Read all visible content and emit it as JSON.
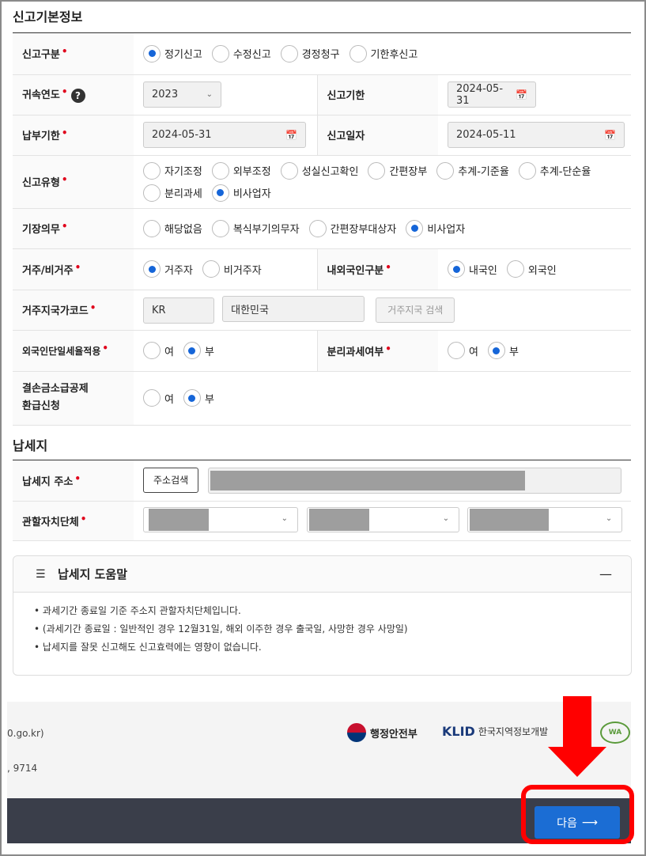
{
  "section_basic": {
    "title": "신고기본정보"
  },
  "rows": {
    "report_type": {
      "label": "신고구분",
      "options": [
        "정기신고",
        "수정신고",
        "경정청구",
        "기한후신고"
      ],
      "selected": 0
    },
    "year": {
      "label": "귀속연도",
      "help_icon": "?",
      "value": "2023"
    },
    "report_deadline": {
      "label": "신고기한",
      "value": "2024-05-31"
    },
    "pay_deadline": {
      "label": "납부기한",
      "value": "2024-05-31"
    },
    "report_date": {
      "label": "신고일자",
      "value": "2024-05-11"
    },
    "report_kind": {
      "label": "신고유형",
      "options": [
        "자기조정",
        "외부조정",
        "성실신고확인",
        "간편장부",
        "추계-기준율",
        "추계-단순율",
        "분리과세",
        "비사업자"
      ],
      "selected": 7
    },
    "bookkeeping": {
      "label": "기장의무",
      "options": [
        "해당없음",
        "복식부기의무자",
        "간편장부대상자",
        "비사업자"
      ],
      "selected": 3
    },
    "residency": {
      "label": "거주/비거주",
      "options": [
        "거주자",
        "비거주자"
      ],
      "selected": 0
    },
    "nationality": {
      "label": "내외국인구분",
      "options": [
        "내국인",
        "외국인"
      ],
      "selected": 0
    },
    "country_code": {
      "label": "거주지국가코드",
      "code": "KR",
      "name": "대한민국",
      "search_button": "거주지국 검색"
    },
    "foreigner_flat_rate": {
      "label": "외국인단일세율적용",
      "options": [
        "여",
        "부"
      ],
      "selected": 1
    },
    "separate_taxation": {
      "label": "분리과세여부",
      "options": [
        "여",
        "부"
      ],
      "selected": 1
    },
    "loss_refund": {
      "label_line1": "결손금소급공제",
      "label_line2": "환급신청",
      "options": [
        "여",
        "부"
      ],
      "selected": 1
    }
  },
  "section_tax_place": {
    "title": "납세지",
    "address_label": "납세지 주소",
    "address_search_button": "주소검색",
    "local_gov_label": "관할자치단체"
  },
  "help_box": {
    "title": "납세지 도움말",
    "collapse_symbol": "—",
    "items": [
      "과세기간 종료일 기준 주소지 관할자치단체입니다.",
      "(과세기간 종료일 : 일반적인 경우 12월31일, 해외 이주한 경우 출국일, 사망한 경우 사망일)",
      "납세지를 잘못 신고해도 신고효력에는 영향이 없습니다."
    ]
  },
  "footer": {
    "url_fragment": "0.go.kr)",
    "phone_fragment": ", 9714",
    "logo_mois": "행정안전부",
    "logo_klid": "KLID",
    "logo_klid_text": "한국지역정보개발",
    "logo_wa": "WA"
  },
  "next_button": {
    "label": "다음",
    "arrow": "⟶"
  },
  "colors": {
    "primary": "#1b6dd4",
    "required": "#e0001b",
    "annotation": "#ff0000",
    "footer_dark": "#3a3e4a"
  }
}
